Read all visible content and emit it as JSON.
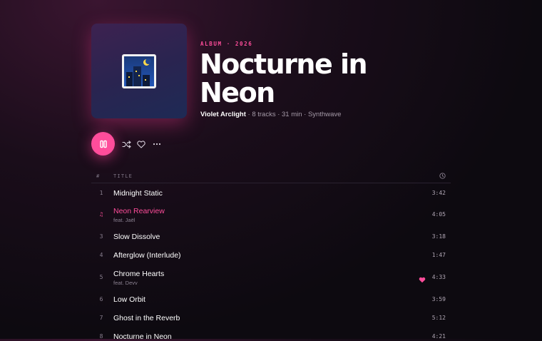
{
  "album": {
    "label": "ALBUM · 2026",
    "title": "Nocturne in Neon",
    "artist": "Violet Arclight",
    "details": " · 8 tracks · 31 min · Synthwave"
  },
  "controls": {
    "play_state": "playing",
    "icons": [
      "pause-icon",
      "shuffle-icon",
      "heart-outline-icon",
      "more-icon"
    ]
  },
  "list_header": {
    "number": "#",
    "title": "TITLE",
    "duration_icon": "clock-icon"
  },
  "tracks": [
    {
      "number": "1",
      "title": "Midnight Static",
      "feat": "",
      "duration": "3:42",
      "active": false,
      "liked": false
    },
    {
      "number": "♫",
      "title": "Neon Rearview",
      "feat": "feat. Jaël",
      "duration": "4:05",
      "active": true,
      "liked": false
    },
    {
      "number": "3",
      "title": "Slow Dissolve",
      "feat": "",
      "duration": "3:18",
      "active": false,
      "liked": false
    },
    {
      "number": "4",
      "title": "Afterglow (Interlude)",
      "feat": "",
      "duration": "1:47",
      "active": false,
      "liked": false
    },
    {
      "number": "5",
      "title": "Chrome Hearts",
      "feat": "feat. Devv",
      "duration": "4:33",
      "active": false,
      "liked": true
    },
    {
      "number": "6",
      "title": "Low Orbit",
      "feat": "",
      "duration": "3:59",
      "active": false,
      "liked": false
    },
    {
      "number": "7",
      "title": "Ghost in the Reverb",
      "feat": "",
      "duration": "5:12",
      "active": false,
      "liked": false
    },
    {
      "number": "8",
      "title": "Nocturne in Neon",
      "feat": "",
      "duration": "4:21",
      "active": false,
      "liked": false
    }
  ],
  "colors": {
    "accent": "#ff4d9b",
    "background": "#0d0a10",
    "muted_text": "#8a8090"
  }
}
